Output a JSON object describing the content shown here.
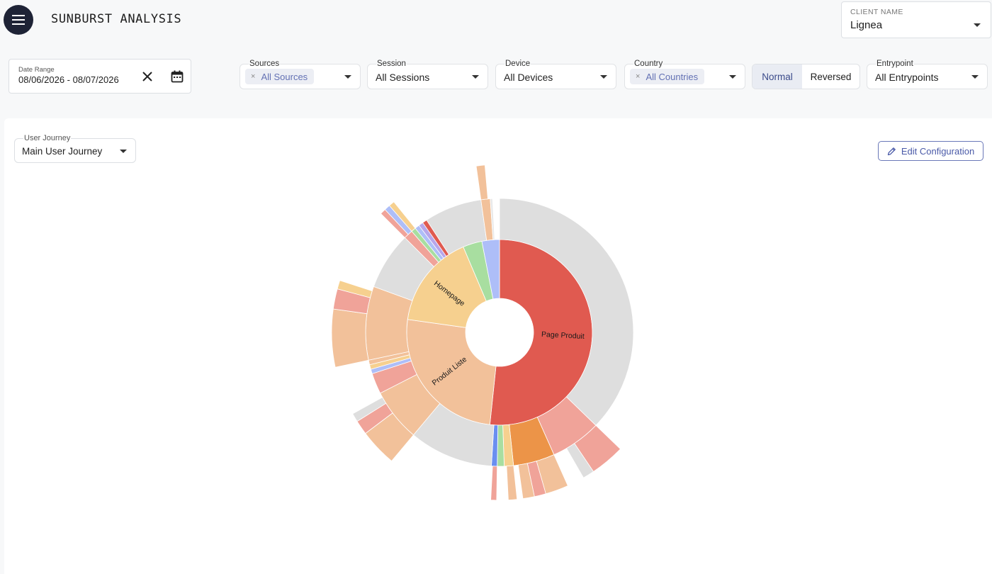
{
  "header": {
    "title": "SUNBURST ANALYSIS",
    "client_label": "CLIENT NAME",
    "client_value": "Lignea"
  },
  "filters": {
    "date_label": "Date Range",
    "date_value": "08/06/2026 - 08/07/2026",
    "sources_label": "Sources",
    "sources_chip": "All Sources",
    "session_label": "Session",
    "session_value": "All Sessions",
    "device_label": "Device",
    "device_value": "All Devices",
    "country_label": "Country",
    "country_chip": "All Countries",
    "toggle_normal": "Normal",
    "toggle_reversed": "Reversed",
    "entrypoint_label": "Entrypoint",
    "entrypoint_value": "All Entrypoints"
  },
  "panel": {
    "journey_label": "User Journey",
    "journey_value": "Main User Journey",
    "edit_label": "Edit Configuration"
  },
  "colors": {
    "accent": "#4a5aa8",
    "menu_bg": "#1e2336",
    "page_produit": "#e05a50",
    "produit_liste": "#f2c19a",
    "homepage": "#f6d08f",
    "gray_exit": "#dedede"
  },
  "chart_data": {
    "type": "sunburst",
    "labels": [
      "Page Produit",
      "Produit Liste",
      "Homepage"
    ],
    "levels": [
      [
        {
          "label": "Page Produit",
          "start": 0,
          "end": 186,
          "color": "#e05a50"
        },
        {
          "label": "Produit Liste",
          "start": 186,
          "end": 278,
          "color": "#f2c19a"
        },
        {
          "label": "Homepage",
          "start": 278,
          "end": 337,
          "color": "#f6d08f"
        },
        {
          "start": 337,
          "end": 349,
          "color": "#a8dea0"
        },
        {
          "start": 349,
          "end": 360,
          "color": "#aebef8"
        }
      ],
      [
        {
          "start": 0,
          "end": 134,
          "color": "#dedede"
        },
        {
          "start": 134,
          "end": 156,
          "color": "#f0a399"
        },
        {
          "start": 156,
          "end": 174,
          "color": "#ec9448"
        },
        {
          "start": 174,
          "end": 178,
          "color": "#f6d08f"
        },
        {
          "start": 178,
          "end": 181,
          "color": "#a8dea0"
        },
        {
          "start": 181,
          "end": 183.5,
          "color": "#6a8ff0"
        },
        {
          "start": 183.5,
          "end": 220,
          "color": "#dedede"
        },
        {
          "start": 220,
          "end": 243,
          "color": "#f2c19a"
        },
        {
          "start": 243,
          "end": 252,
          "color": "#f0a399"
        },
        {
          "start": 252,
          "end": 254,
          "color": "#aebef8"
        },
        {
          "start": 254,
          "end": 256,
          "color": "#f6d08f"
        },
        {
          "start": 256,
          "end": 258,
          "color": "#f2c19a"
        },
        {
          "start": 258,
          "end": 290,
          "color": "#f2c19a"
        },
        {
          "start": 290,
          "end": 315,
          "color": "#dedede"
        },
        {
          "start": 315,
          "end": 319,
          "color": "#f0a399"
        },
        {
          "start": 319,
          "end": 321,
          "color": "#a8dea0"
        },
        {
          "start": 321,
          "end": 323,
          "color": "#aebef8"
        },
        {
          "start": 323,
          "end": 325,
          "color": "#b7a6ea"
        },
        {
          "start": 325,
          "end": 327,
          "color": "#e05a50"
        },
        {
          "start": 327,
          "end": 352,
          "color": "#dedede"
        },
        {
          "start": 352,
          "end": 356,
          "color": "#f2c19a"
        },
        {
          "start": 356,
          "end": 357,
          "color": "#e8e8e8"
        }
      ],
      [
        {
          "start": 134,
          "end": 146,
          "color": "#f0a399"
        },
        {
          "start": 146,
          "end": 150,
          "color": "#dedede"
        },
        {
          "start": 156,
          "end": 164,
          "color": "#f2c19a"
        },
        {
          "start": 164,
          "end": 168,
          "color": "#f0a399"
        },
        {
          "start": 168,
          "end": 172,
          "color": "#f2c19a"
        },
        {
          "start": 174,
          "end": 177,
          "color": "#f2c19a"
        },
        {
          "start": 181,
          "end": 183,
          "color": "#f0a399"
        },
        {
          "start": 220,
          "end": 233,
          "color": "#f2c19a"
        },
        {
          "start": 233,
          "end": 238,
          "color": "#f0a399"
        },
        {
          "start": 238,
          "end": 241,
          "color": "#dedede"
        },
        {
          "start": 258,
          "end": 278,
          "color": "#f2c19a"
        },
        {
          "start": 278,
          "end": 285,
          "color": "#f0a399"
        },
        {
          "start": 285,
          "end": 288,
          "color": "#f6d08f"
        },
        {
          "start": 315,
          "end": 317,
          "color": "#f0a399"
        },
        {
          "start": 317,
          "end": 319,
          "color": "#aebef8"
        },
        {
          "start": 319,
          "end": 321,
          "color": "#f6d08f"
        },
        {
          "start": 352,
          "end": 355,
          "color": "#f2c19a"
        }
      ]
    ]
  }
}
